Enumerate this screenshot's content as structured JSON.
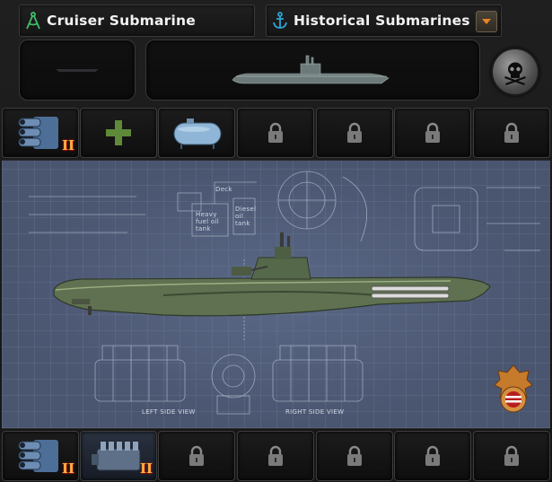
{
  "header": {
    "design_name": "Cruiser Submarine",
    "design_icon": "compass-icon",
    "variant_name": "Historical Submarines",
    "variant_icon": "anchor-icon",
    "dropdown_icon": "chevron-down-icon"
  },
  "controls": {
    "pirate_icon": "skull-crossbones-icon"
  },
  "top_slots": [
    {
      "icon": "torpedo-launcher-icon",
      "tier": "II"
    },
    {
      "icon": "add-icon",
      "tier": ""
    },
    {
      "icon": "fuel-tank-icon",
      "tier": ""
    },
    {
      "icon": "lock-icon",
      "tier": ""
    },
    {
      "icon": "lock-icon",
      "tier": ""
    },
    {
      "icon": "lock-icon",
      "tier": ""
    },
    {
      "icon": "lock-icon",
      "tier": ""
    }
  ],
  "bottom_slots": [
    {
      "icon": "torpedo-launcher-icon",
      "tier": "II"
    },
    {
      "icon": "diesel-engine-icon",
      "tier": "II"
    },
    {
      "icon": "lock-icon",
      "tier": ""
    },
    {
      "icon": "lock-icon",
      "tier": ""
    },
    {
      "icon": "lock-icon",
      "tier": ""
    },
    {
      "icon": "lock-icon",
      "tier": ""
    },
    {
      "icon": "lock-icon",
      "tier": ""
    }
  ],
  "blueprint": {
    "label_left_view": "LEFT SIDE VIEW",
    "label_right_view": "RIGHT SIDE VIEW",
    "label_deck": "Deck",
    "label_fuel": "Heavy fuel oil tank",
    "label_oil": "Diesel oil tank",
    "role_badge_icon": "submarine-role-badge-icon"
  }
}
